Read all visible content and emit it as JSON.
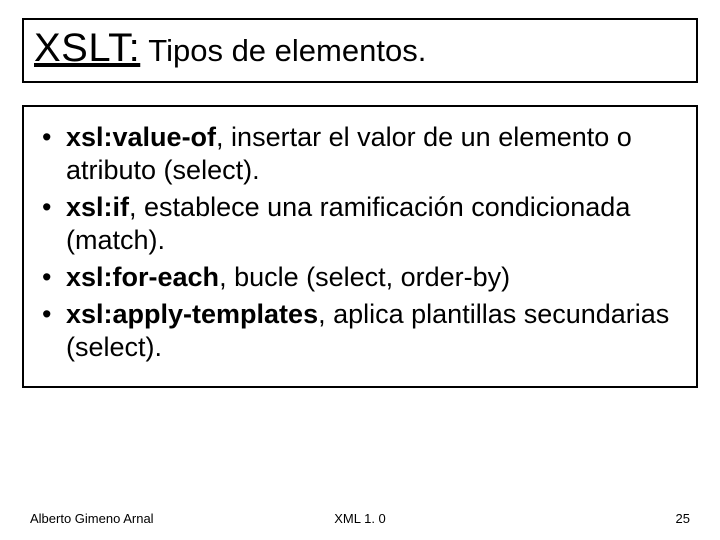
{
  "title": {
    "main": "XSLT:",
    "sub": " Tipos de elementos."
  },
  "bullets": [
    {
      "bold": "xsl:value-of",
      "rest": ", insertar el valor de un elemento o atributo (select)."
    },
    {
      "bold": "xsl:if",
      "rest": ", establece una ramificación condicionada (match)."
    },
    {
      "bold": "xsl:for-each",
      "rest": ", bucle (select, order-by)"
    },
    {
      "bold": "xsl:apply-templates",
      "rest": ", aplica plantillas secundarias (select)."
    }
  ],
  "footer": {
    "author": "Alberto Gimeno Arnal",
    "center": "XML 1. 0",
    "page": "25"
  }
}
